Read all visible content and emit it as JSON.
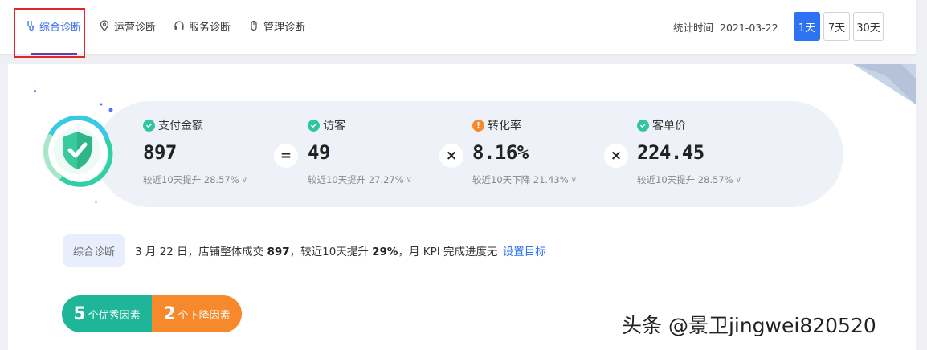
{
  "tabs": [
    {
      "label": "综合诊断",
      "icon": "diagnosis-icon",
      "active": true
    },
    {
      "label": "运营诊断",
      "icon": "location-icon",
      "active": false
    },
    {
      "label": "服务诊断",
      "icon": "headset-icon",
      "active": false
    },
    {
      "label": "管理诊断",
      "icon": "tag-icon",
      "active": false
    }
  ],
  "stat_time": {
    "label": "统计时间",
    "date": "2021-03-22"
  },
  "range_buttons": [
    {
      "label": "1天",
      "active": true
    },
    {
      "label": "7天",
      "active": false
    },
    {
      "label": "30天",
      "active": false
    }
  ],
  "metrics": [
    {
      "label": "支付金额",
      "value": "897",
      "compare": "较近10天提升 28.57%",
      "status": "ok"
    },
    {
      "label": "访客",
      "value": "49",
      "compare": "较近10天提升 27.27%",
      "status": "ok"
    },
    {
      "label": "转化率",
      "value": "8.16%",
      "compare": "较近10天下降 21.43%",
      "status": "warn"
    },
    {
      "label": "客单价",
      "value": "224.45",
      "compare": "较近10天提升 28.57%",
      "status": "ok"
    }
  ],
  "operators": [
    "=",
    "×",
    "×"
  ],
  "diagnosis": {
    "tag": "综合诊断",
    "prefix": "3 月 22 日，店铺整体成交",
    "amount": "897",
    "middle": "，较近10天提升",
    "percent": "29%",
    "suffix": "，月 KPI 完成进度无",
    "link": "设置目标"
  },
  "pills": {
    "good": {
      "count": "5",
      "label": "个优秀因素"
    },
    "bad": {
      "count": "2",
      "label": "个下降因素"
    }
  },
  "watermark": "头条 @景卫jingwei820520",
  "colors": {
    "primary": "#2d72f0",
    "success": "#2ec5a0",
    "warning": "#f5892c",
    "highlight": "#e0272b"
  }
}
